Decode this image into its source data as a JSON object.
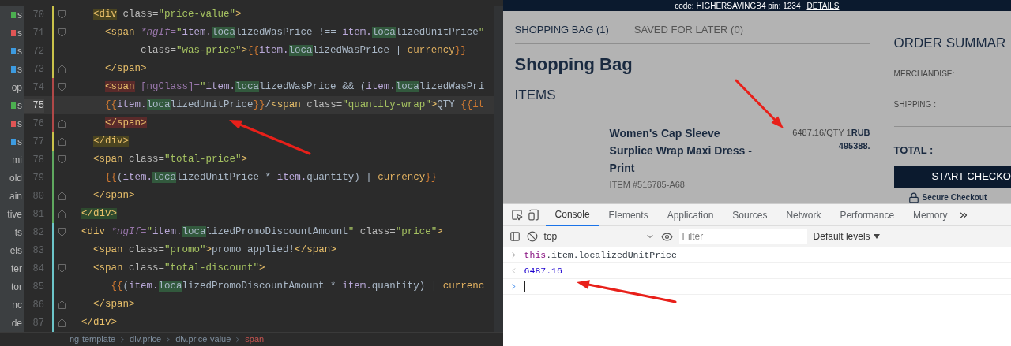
{
  "editor": {
    "tree_rows": [
      {
        "text": "s",
        "color": "#4caf50"
      },
      {
        "text": "s",
        "color": "#e05555"
      },
      {
        "text": "s",
        "color": "#3d9be0"
      },
      {
        "text": "s",
        "color": "#3d9be0"
      },
      {
        "text": "op"
      },
      {
        "text": "s",
        "color": "#4caf50"
      },
      {
        "text": "s",
        "color": "#e05555"
      },
      {
        "text": "s",
        "color": "#3d9be0"
      },
      {
        "text": "mi"
      },
      {
        "text": "old"
      },
      {
        "text": "ain"
      },
      {
        "text": "tive"
      },
      {
        "text": "ts"
      },
      {
        "text": "els"
      },
      {
        "text": "ter"
      },
      {
        "text": "tor"
      },
      {
        "text": "nc"
      },
      {
        "text": "de"
      }
    ],
    "lines": [
      {
        "number": "70",
        "current": false,
        "fold": {
          "kind": "start"
        },
        "color": "#c9c24a",
        "tokens": [
          {
            "text": "    <div ",
            "kind": "tagY"
          },
          {
            "text": "class=",
            "kind": "attr"
          },
          {
            "text": "\"price-value\"",
            "kind": "str"
          },
          {
            "text": ">",
            "kind": "tag"
          }
        ]
      },
      {
        "number": "71",
        "current": false,
        "fold": {
          "kind": "start"
        },
        "color": "#c9c24a",
        "tokens": [
          {
            "text": "      <span ",
            "kind": "tag"
          },
          {
            "text": "*ngIf=",
            "kind": "ng"
          },
          {
            "text": "\"",
            "kind": "str"
          },
          {
            "text": "item.",
            "kind": "ident"
          },
          {
            "text": "loca",
            "kind": "match"
          },
          {
            "text": "lizedWasPrice !== ",
            "kind": "plain"
          },
          {
            "text": "item.",
            "kind": "ident"
          },
          {
            "text": "loca",
            "kind": "match"
          },
          {
            "text": "lizedUnitPrice",
            "kind": "plain"
          },
          {
            "text": "\"",
            "kind": "str"
          }
        ]
      },
      {
        "number": "72",
        "current": false,
        "color": "#c9c24a",
        "tokens": [
          {
            "text": "            class=",
            "kind": "attr"
          },
          {
            "text": "\"was-price\"",
            "kind": "str"
          },
          {
            "text": ">",
            "kind": "tag"
          },
          {
            "text": "{{",
            "kind": "brace"
          },
          {
            "text": "item.",
            "kind": "ident"
          },
          {
            "text": "loca",
            "kind": "match"
          },
          {
            "text": "lizedWasPrice | ",
            "kind": "plain"
          },
          {
            "text": "currency",
            "kind": "pipe"
          },
          {
            "text": "}}",
            "kind": "brace"
          }
        ]
      },
      {
        "number": "73",
        "current": false,
        "fold": {
          "kind": "end"
        },
        "color": "#c9c24a",
        "tokens": [
          {
            "text": "      </span>",
            "kind": "tag"
          }
        ]
      },
      {
        "number": "74",
        "current": false,
        "fold": {
          "kind": "start"
        },
        "color": "#b04848",
        "tokens": [
          {
            "text": "      <span ",
            "kind": "tagR"
          },
          {
            "text": "[ngClass]=",
            "kind": "bind"
          },
          {
            "text": "\"",
            "kind": "str"
          },
          {
            "text": "item.",
            "kind": "ident"
          },
          {
            "text": "loca",
            "kind": "match"
          },
          {
            "text": "lizedWasPrice && (",
            "kind": "plain"
          },
          {
            "text": "item.",
            "kind": "ident"
          },
          {
            "text": "loca",
            "kind": "match"
          },
          {
            "text": "lizedWasPri",
            "kind": "plain"
          }
        ]
      },
      {
        "number": "75",
        "current": true,
        "color": "#b04848",
        "tokens": [
          {
            "text": "      {{",
            "kind": "brace"
          },
          {
            "text": "item.",
            "kind": "ident"
          },
          {
            "text": "loca",
            "kind": "match"
          },
          {
            "text": "lizedUnitPrice",
            "kind": "plain"
          },
          {
            "text": "}}",
            "kind": "brace"
          },
          {
            "text": "/",
            "kind": "plain"
          },
          {
            "text": "<span ",
            "kind": "tag"
          },
          {
            "text": "class=",
            "kind": "attr"
          },
          {
            "text": "\"quantity-wrap\"",
            "kind": "str"
          },
          {
            "text": ">",
            "kind": "tag"
          },
          {
            "text": "QTY ",
            "kind": "plain"
          },
          {
            "text": "{{it",
            "kind": "brace"
          }
        ]
      },
      {
        "number": "76",
        "current": false,
        "fold": {
          "kind": "end"
        },
        "color": "#b04848",
        "tokens": [
          {
            "text": "      </span>",
            "kind": "tagR"
          }
        ]
      },
      {
        "number": "77",
        "current": false,
        "fold": {
          "kind": "end"
        },
        "color": "#c9c24a",
        "tokens": [
          {
            "text": "    </div>",
            "kind": "tagY"
          }
        ]
      },
      {
        "number": "78",
        "current": false,
        "fold": {
          "kind": "start"
        },
        "color": "#5fa85f",
        "tokens": [
          {
            "text": "    <span ",
            "kind": "tag"
          },
          {
            "text": "class=",
            "kind": "attr"
          },
          {
            "text": "\"total-price\"",
            "kind": "str"
          },
          {
            "text": ">",
            "kind": "tag"
          }
        ]
      },
      {
        "number": "79",
        "current": false,
        "color": "#5fa85f",
        "tokens": [
          {
            "text": "      {{",
            "kind": "brace"
          },
          {
            "text": "(",
            "kind": "plain"
          },
          {
            "text": "item.",
            "kind": "ident"
          },
          {
            "text": "loca",
            "kind": "match"
          },
          {
            "text": "lizedUnitPrice * ",
            "kind": "plain"
          },
          {
            "text": "item.",
            "kind": "ident"
          },
          {
            "text": "quantity) | ",
            "kind": "plain"
          },
          {
            "text": "currency",
            "kind": "pipe"
          },
          {
            "text": "}}",
            "kind": "brace"
          }
        ]
      },
      {
        "number": "80",
        "current": false,
        "fold": {
          "kind": "end"
        },
        "color": "#5fa85f",
        "tokens": [
          {
            "text": "    </span>",
            "kind": "tag"
          }
        ]
      },
      {
        "number": "81",
        "current": false,
        "fold": {
          "kind": "end"
        },
        "color": "#5fa85f",
        "tokens": [
          {
            "text": "  </div>",
            "kind": "tagG"
          }
        ]
      },
      {
        "number": "82",
        "current": false,
        "fold": {
          "kind": "start"
        },
        "color": "#6cc5c9",
        "tokens": [
          {
            "text": "  <div ",
            "kind": "tag"
          },
          {
            "text": "*ngIf=",
            "kind": "ng"
          },
          {
            "text": "\"",
            "kind": "str"
          },
          {
            "text": "item.",
            "kind": "ident"
          },
          {
            "text": "loca",
            "kind": "match"
          },
          {
            "text": "lizedPromoDiscountAmount",
            "kind": "plain"
          },
          {
            "text": "\" ",
            "kind": "str"
          },
          {
            "text": "class=",
            "kind": "attr"
          },
          {
            "text": "\"price\"",
            "kind": "str"
          },
          {
            "text": ">",
            "kind": "tag"
          }
        ]
      },
      {
        "number": "83",
        "current": false,
        "color": "#6cc5c9",
        "tokens": [
          {
            "text": "    <span ",
            "kind": "tag"
          },
          {
            "text": "class=",
            "kind": "attr"
          },
          {
            "text": "\"promo\"",
            "kind": "str"
          },
          {
            "text": ">",
            "kind": "tag"
          },
          {
            "text": "promo applied!",
            "kind": "plain"
          },
          {
            "text": "</span>",
            "kind": "tag"
          }
        ]
      },
      {
        "number": "84",
        "current": false,
        "fold": {
          "kind": "start"
        },
        "color": "#6cc5c9",
        "tokens": [
          {
            "text": "    <span ",
            "kind": "tag"
          },
          {
            "text": "class=",
            "kind": "attr"
          },
          {
            "text": "\"total-discount\"",
            "kind": "str"
          },
          {
            "text": ">",
            "kind": "tag"
          }
        ]
      },
      {
        "number": "85",
        "current": false,
        "color": "#6cc5c9",
        "tokens": [
          {
            "text": "       {{",
            "kind": "brace"
          },
          {
            "text": "(",
            "kind": "plain"
          },
          {
            "text": "item.",
            "kind": "ident"
          },
          {
            "text": "loca",
            "kind": "match"
          },
          {
            "text": "lizedPromoDiscountAmount * ",
            "kind": "plain"
          },
          {
            "text": "item.",
            "kind": "ident"
          },
          {
            "text": "quantity) | ",
            "kind": "plain"
          },
          {
            "text": "currenc",
            "kind": "pipe"
          }
        ]
      },
      {
        "number": "86",
        "current": false,
        "fold": {
          "kind": "end"
        },
        "color": "#6cc5c9",
        "tokens": [
          {
            "text": "    </span>",
            "kind": "tag"
          }
        ]
      },
      {
        "number": "87",
        "current": false,
        "fold": {
          "kind": "end"
        },
        "color": "#6cc5c9",
        "tokens": [
          {
            "text": "  </div>",
            "kind": "tag"
          }
        ]
      }
    ],
    "breadcrumb": [
      {
        "label": "ng-template",
        "selected": false
      },
      {
        "label": "div.price",
        "selected": false
      },
      {
        "label": "div.price-value",
        "selected": false
      },
      {
        "label": "span",
        "selected": true
      }
    ]
  },
  "page": {
    "banner": {
      "text": "code: HIGHERSAVINGB4 pin: 1234",
      "link": "DETAILS"
    },
    "tabs": [
      {
        "label": "SHOPPING BAG (1)",
        "selected": true
      },
      {
        "label": "SAVED FOR LATER (0)",
        "selected": false
      }
    ],
    "heading": "Shopping Bag",
    "section": "ITEMS",
    "item": {
      "title": "Women's Cap Sleeve Surplice Wrap Maxi Dress - Print",
      "number": "ITEM #516785-A68",
      "unit_price": "6487.16/QTY 1",
      "currency": "RUB",
      "total": "495388."
    },
    "summary": {
      "title": "ORDER SUMMAR",
      "merchandise": "MERCHANDISE:",
      "shipping": "SHIPPING :",
      "total": "TOTAL :",
      "checkout": "START CHECKO",
      "secure": "Secure Checkout"
    }
  },
  "devtools": {
    "tabs": [
      {
        "label": "Console",
        "selected": true
      },
      {
        "label": "Elements",
        "selected": false
      },
      {
        "label": "Application",
        "selected": false
      },
      {
        "label": "Sources",
        "selected": false
      },
      {
        "label": "Network",
        "selected": false
      },
      {
        "label": "Performance",
        "selected": false
      },
      {
        "label": "Memory",
        "selected": false
      }
    ],
    "context": "top",
    "filter_placeholder": "Filter",
    "levels": "Default levels",
    "entries": [
      {
        "kind": "input",
        "tokens": [
          {
            "text": "this",
            "kind": "keyword"
          },
          {
            "text": ".item.localizedUnitPrice",
            "kind": "plain"
          }
        ]
      },
      {
        "kind": "output",
        "tokens": [
          {
            "text": "6487.16",
            "kind": "number"
          }
        ]
      },
      {
        "kind": "prompt"
      }
    ]
  }
}
